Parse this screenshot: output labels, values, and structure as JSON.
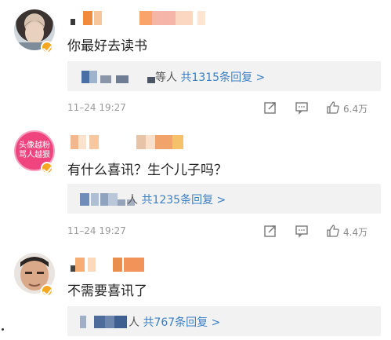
{
  "comments": [
    {
      "text": "你最好去读书",
      "reply_suffix": "等人",
      "reply_count": "共1315条回复 >",
      "time": "11–24 19:27",
      "likes": "6.4万",
      "icons": [
        "share-icon",
        "comment-icon",
        "like-icon"
      ]
    },
    {
      "avatar_text_line1": "头像越粉",
      "avatar_text_line2": "骂人越狠",
      "text": "有什么喜讯？生个儿子吗？",
      "reply_suffix": "人",
      "reply_count": "共1235条回复 >",
      "time": "11–24 19:27",
      "likes": "4.4万",
      "icons": [
        "share-icon",
        "comment-icon",
        "like-icon"
      ]
    },
    {
      "text": "不需要喜讯了",
      "reply_suffix": "人",
      "reply_count": "共767条回复 >"
    }
  ],
  "colors": {
    "accent": "#3b7fc4",
    "verified_badge": "#f5a623",
    "reply_bg": "#f2f2f2",
    "avatar2_bg": "#f0447f"
  }
}
